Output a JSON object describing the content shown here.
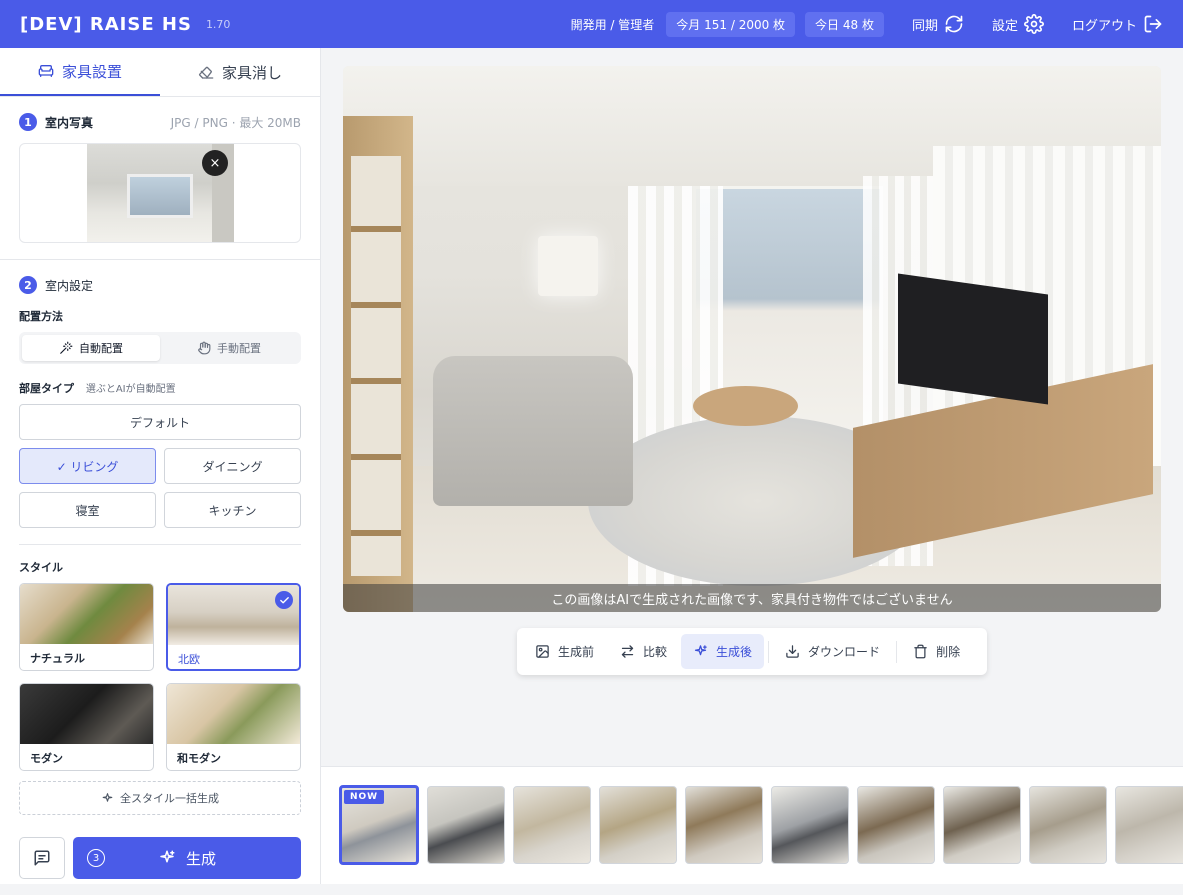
{
  "header": {
    "title": "[DEV] RAISE HS",
    "version": "1.70",
    "role": "開発用 / 管理者",
    "monthly_quota": "今月 151 / 2000 枚",
    "daily_count": "今日 48 枚",
    "sync_label": "同期",
    "settings_label": "設定",
    "logout_label": "ログアウト"
  },
  "tabs": [
    {
      "label": "家具設置",
      "icon": "sofa-icon",
      "active": true
    },
    {
      "label": "家具消し",
      "icon": "eraser-icon",
      "active": false
    }
  ],
  "step1": {
    "number": "1",
    "title": "室内写真",
    "hint": "JPG / PNG · 最大 20MB",
    "remove_symbol": "×"
  },
  "step2": {
    "number": "2",
    "title": "室内設定",
    "placement_label": "配置方法",
    "placement_options": [
      {
        "label": "自動配置",
        "icon": "magic-wand-icon",
        "active": true
      },
      {
        "label": "手動配置",
        "icon": "hand-pointer-icon",
        "active": false
      }
    ],
    "room_type_label": "部屋タイプ",
    "room_type_hint": "選ぶとAIが自動配置",
    "room_default": "デフォルト",
    "room_types": [
      {
        "label": "✓ リビング",
        "active": true
      },
      {
        "label": "ダイニング",
        "active": false
      },
      {
        "label": "寝室",
        "active": false
      },
      {
        "label": "キッチン",
        "active": false
      }
    ],
    "style_label": "スタイル",
    "styles": [
      {
        "label": "ナチュラル",
        "active": false
      },
      {
        "label": "北欧",
        "active": true
      },
      {
        "label": "モダン",
        "active": false
      },
      {
        "label": "和モダン",
        "active": false
      }
    ],
    "batch_label": "全スタイル一括生成",
    "generate_count": "3",
    "generate_label": "生成"
  },
  "preview": {
    "caption": "この画像はAIで生成された画像です、家具付き物件ではございません"
  },
  "toolbar": [
    {
      "label": "生成前",
      "icon": "image-icon",
      "active": false
    },
    {
      "label": "比較",
      "icon": "swap-icon",
      "active": false
    },
    {
      "label": "生成後",
      "icon": "sparkle-icon",
      "active": true
    },
    {
      "label": "ダウンロード",
      "icon": "download-icon",
      "active": false
    },
    {
      "label": "削除",
      "icon": "trash-icon",
      "active": false
    }
  ],
  "history": {
    "now_badge": "NOW",
    "count": 10
  },
  "colors": {
    "primary": "#4a5be8",
    "header_bg": "#4a5be8",
    "active_tab": "#3b4fd8",
    "selected_bg": "#e4e9fb"
  }
}
